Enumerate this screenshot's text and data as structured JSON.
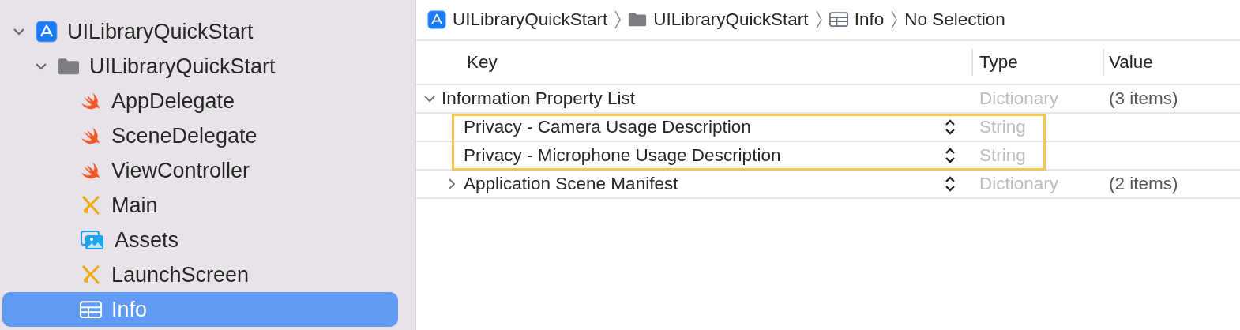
{
  "sidebar": {
    "items": [
      {
        "label": "UILibraryQuickStart",
        "kind": "project",
        "expanded": true,
        "selected": false,
        "children": [
          {
            "label": "UILibraryQuickStart",
            "kind": "folder",
            "expanded": true,
            "selected": false,
            "children": [
              {
                "label": "AppDelegate",
                "kind": "swift",
                "selected": false
              },
              {
                "label": "SceneDelegate",
                "kind": "swift",
                "selected": false
              },
              {
                "label": "ViewController",
                "kind": "swift",
                "selected": false
              },
              {
                "label": "Main",
                "kind": "storyboard",
                "selected": false
              },
              {
                "label": "Assets",
                "kind": "assets",
                "selected": false
              },
              {
                "label": "LaunchScreen",
                "kind": "storyboard",
                "selected": false
              },
              {
                "label": "Info",
                "kind": "plist",
                "selected": true
              }
            ]
          }
        ]
      }
    ]
  },
  "breadcrumb": [
    {
      "label": "UILibraryQuickStart",
      "kind": "project"
    },
    {
      "label": "UILibraryQuickStart",
      "kind": "folder"
    },
    {
      "label": "Info",
      "kind": "plist"
    },
    {
      "label": "No Selection",
      "kind": "text"
    }
  ],
  "table": {
    "columns": [
      "Key",
      "Type",
      "Value"
    ],
    "rows": [
      {
        "key": "Information Property List",
        "type": "Dictionary",
        "value": "(3 items)",
        "expanded": true,
        "stepper": false,
        "children": [
          {
            "key": "Privacy - Camera Usage Description",
            "type": "String",
            "stepper": true,
            "highlighted": true
          },
          {
            "key": "Privacy - Microphone Usage Description",
            "type": "String",
            "stepper": true,
            "highlighted": true
          },
          {
            "key": "Application Scene Manifest",
            "type": "Dictionary",
            "value": "(2 items)",
            "expanded": false,
            "stepper": true,
            "highlighted": false
          }
        ]
      }
    ]
  }
}
